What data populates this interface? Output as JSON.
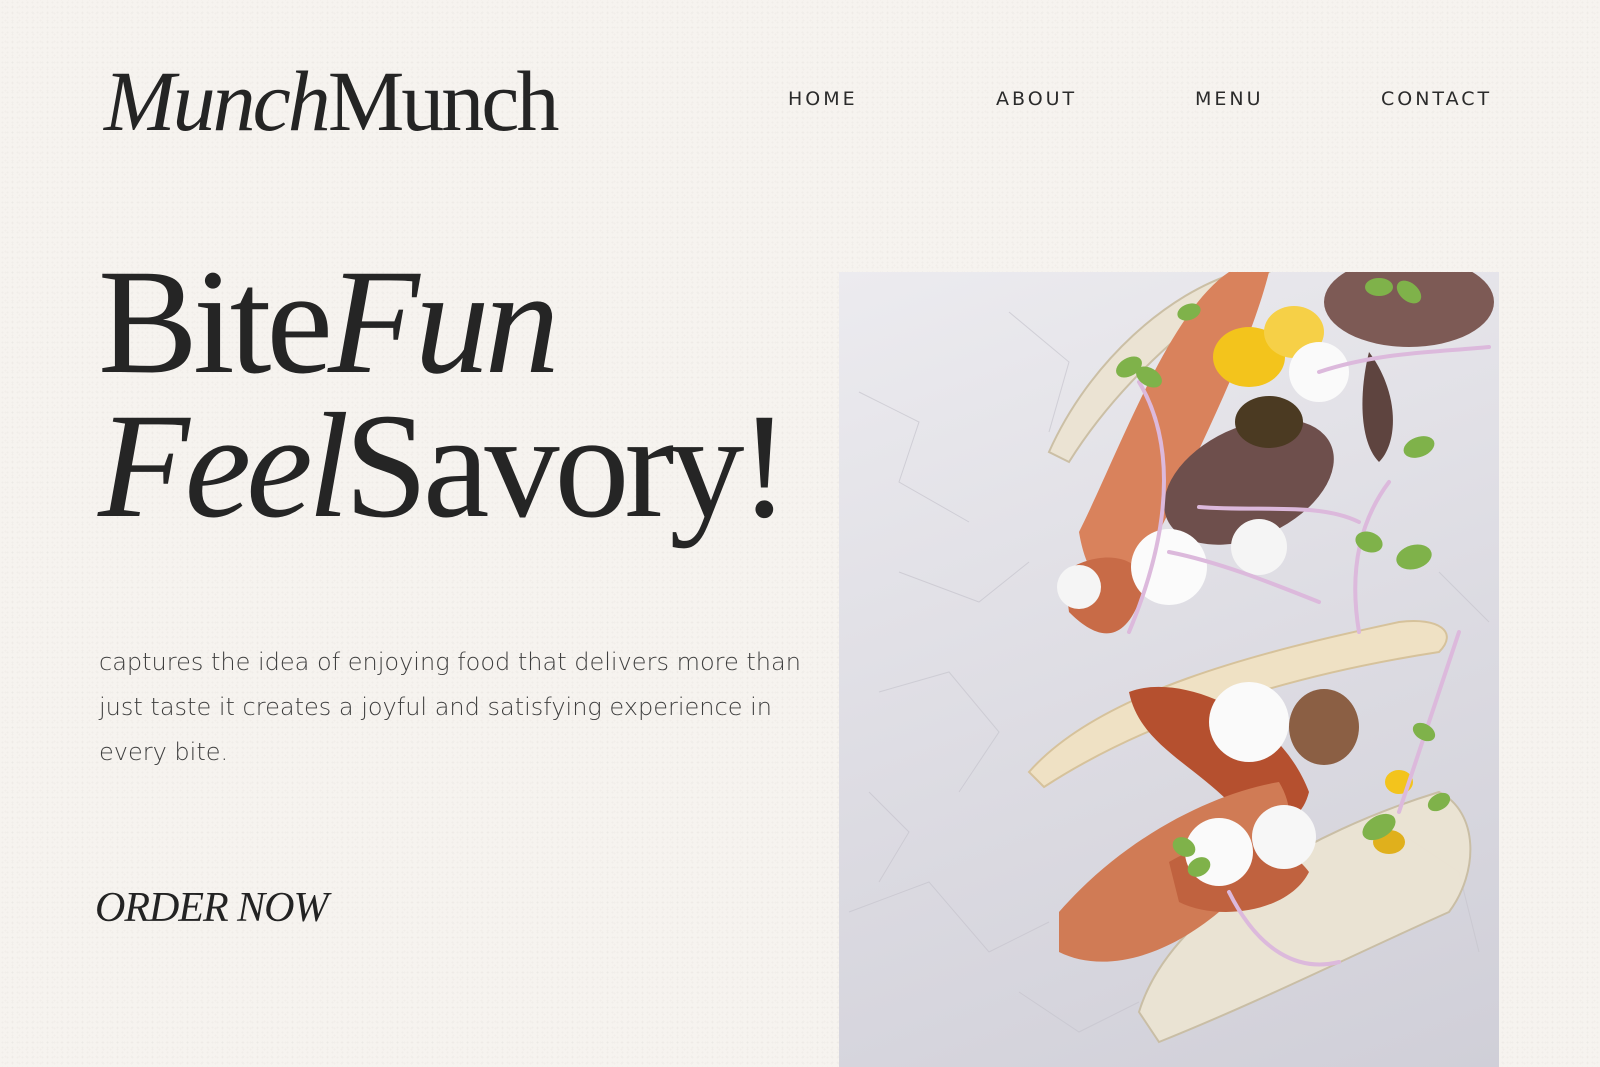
{
  "brand": {
    "logo_part1": "Munch",
    "logo_part2": "Munch"
  },
  "nav": {
    "home": "HOME",
    "about": "ABOUT",
    "menu": "MENU",
    "contact": "CONTACT"
  },
  "hero": {
    "headline_line1_a": "Bite",
    "headline_line1_b": "Fun",
    "headline_line2_a": "Feel",
    "headline_line2_b": "Savory!",
    "description": "captures the idea of enjoying food that delivers more than just taste it creates a joyful and satisfying experience in every bite.",
    "cta_label": "ORDER NOW"
  },
  "colors": {
    "background": "#f6f3ef",
    "text": "#232323",
    "plate": "#dcdbe2"
  }
}
